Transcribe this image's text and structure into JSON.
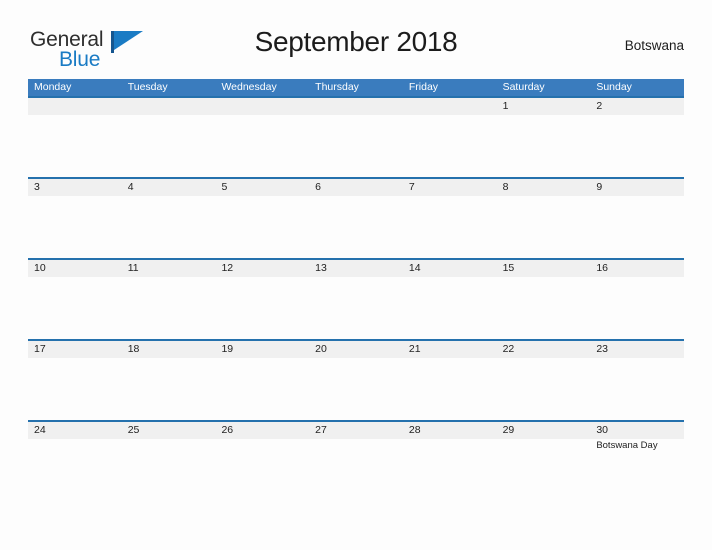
{
  "brand": {
    "name_part1": "General",
    "name_part2": "Blue",
    "icon": "flag-icon",
    "color_primary": "#1a7bc4",
    "color_dark": "#15568f"
  },
  "header": {
    "title": "September 2018",
    "region": "Botswana"
  },
  "colors": {
    "header_blue": "#3a7cbe",
    "row_border_blue": "#2571ad",
    "date_band_gray": "#f0f0f0",
    "page_background": "#fdfdfd",
    "text": "#222222"
  },
  "calendar": {
    "month": "September",
    "year": "2018",
    "weekday_headers": [
      "Monday",
      "Tuesday",
      "Wednesday",
      "Thursday",
      "Friday",
      "Saturday",
      "Sunday"
    ],
    "weeks": [
      [
        {
          "day": "",
          "event": ""
        },
        {
          "day": "",
          "event": ""
        },
        {
          "day": "",
          "event": ""
        },
        {
          "day": "",
          "event": ""
        },
        {
          "day": "",
          "event": ""
        },
        {
          "day": "1",
          "event": ""
        },
        {
          "day": "2",
          "event": ""
        }
      ],
      [
        {
          "day": "3",
          "event": ""
        },
        {
          "day": "4",
          "event": ""
        },
        {
          "day": "5",
          "event": ""
        },
        {
          "day": "6",
          "event": ""
        },
        {
          "day": "7",
          "event": ""
        },
        {
          "day": "8",
          "event": ""
        },
        {
          "day": "9",
          "event": ""
        }
      ],
      [
        {
          "day": "10",
          "event": ""
        },
        {
          "day": "11",
          "event": ""
        },
        {
          "day": "12",
          "event": ""
        },
        {
          "day": "13",
          "event": ""
        },
        {
          "day": "14",
          "event": ""
        },
        {
          "day": "15",
          "event": ""
        },
        {
          "day": "16",
          "event": ""
        }
      ],
      [
        {
          "day": "17",
          "event": ""
        },
        {
          "day": "18",
          "event": ""
        },
        {
          "day": "19",
          "event": ""
        },
        {
          "day": "20",
          "event": ""
        },
        {
          "day": "21",
          "event": ""
        },
        {
          "day": "22",
          "event": ""
        },
        {
          "day": "23",
          "event": ""
        }
      ],
      [
        {
          "day": "24",
          "event": ""
        },
        {
          "day": "25",
          "event": ""
        },
        {
          "day": "26",
          "event": ""
        },
        {
          "day": "27",
          "event": ""
        },
        {
          "day": "28",
          "event": ""
        },
        {
          "day": "29",
          "event": ""
        },
        {
          "day": "30",
          "event": "Botswana Day"
        }
      ]
    ]
  }
}
